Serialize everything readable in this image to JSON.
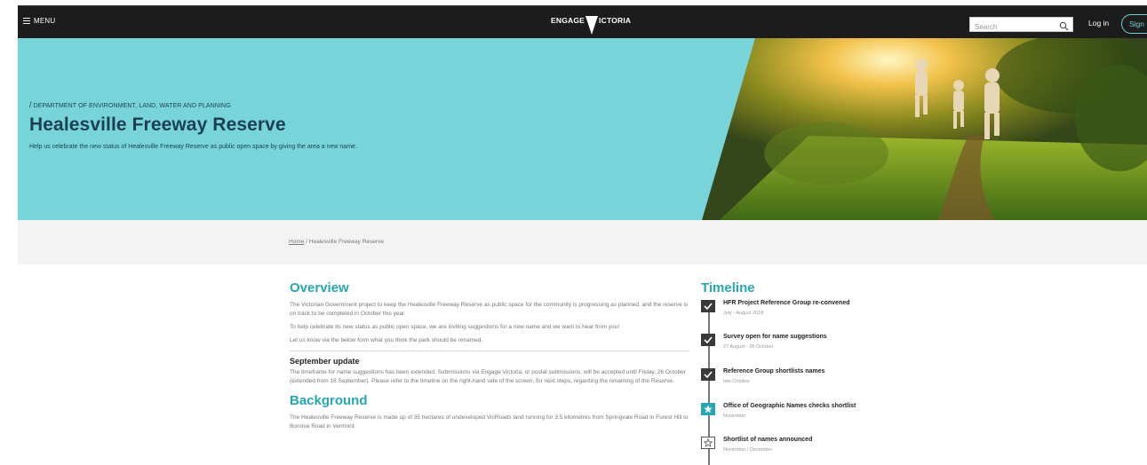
{
  "nav": {
    "menu_label": "MENU",
    "logo_left": "ENGAGE",
    "logo_right": "ICTORIA",
    "search_placeholder": "Search",
    "login_label": "Log in",
    "signup_label": "Sign up"
  },
  "hero": {
    "department": "DEPARTMENT OF ENVIRONMENT, LAND, WATER AND PLANNING",
    "title": "Healesville Freeway Reserve",
    "subtitle": "Help us celebrate the new status of Healesville Freeway Reserve as public open space by giving the area a new name."
  },
  "breadcrumb": {
    "home": "Home",
    "current": "/ Healesville Freeway Reserve"
  },
  "overview": {
    "heading": "Overview",
    "p1": "The Victorian Government project to keep the Healesville Freeway Reserve as public space for the community is progressing as planned, and the reserve is on track to be completed in October this year.",
    "p2": "To help celebrate its new status as public open space, we are inviting suggestions for a new name and we want to hear from you!",
    "p3": "Let us know via the below form what you think the park should be renamed."
  },
  "september": {
    "heading": "September update",
    "p1": "The timeframe for name suggestions has been extended. Submissions via Engage Victoria, or postal submissions, will be accepted until Friday, 26 October (extended from 16 September). Please refer to the timeline on the right-hand side of the screen, for next steps, regarding the renaming of the Reserve."
  },
  "background": {
    "heading": "Background",
    "p1": "The Healesville Freeway Reserve is made up of 35 hectares of undeveloped VicRoads land running for 3.5 kilometres from Springvale Road in Forest Hill to Boronia Road in Vermont."
  },
  "timeline": {
    "heading": "Timeline",
    "items": [
      {
        "label": "HFR Project Reference Group re-convened",
        "date": "July - August 2018",
        "state": "done"
      },
      {
        "label": "Survey open for name suggestions",
        "date": "27 August - 26 October",
        "state": "done"
      },
      {
        "label": "Reference Group shortlists names",
        "date": "late October",
        "state": "done"
      },
      {
        "label": "Office of Geographic Names checks shortlist",
        "date": "November",
        "state": "current"
      },
      {
        "label": "Shortlist of names announced",
        "date": "November / December",
        "state": "upcoming"
      }
    ]
  },
  "colors": {
    "accent": "#22a9b4",
    "hero_bg": "#77d4d9",
    "nav_bg": "#1c1c1c"
  }
}
